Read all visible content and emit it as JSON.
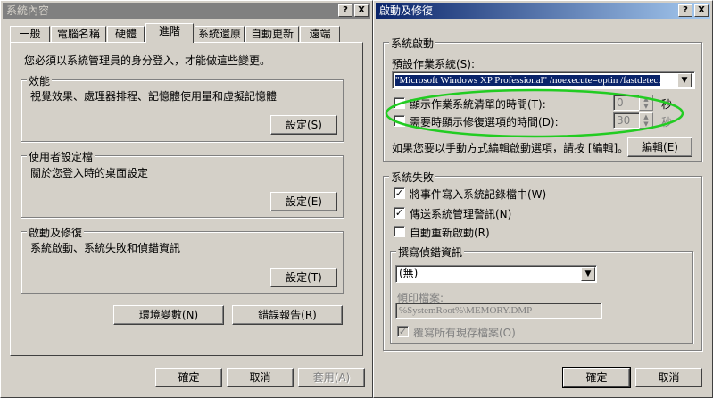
{
  "left": {
    "title": "系統內容",
    "help_btn": "?",
    "close_btn": "X",
    "tabs": [
      "一般",
      "電腦名稱",
      "硬體",
      "進階",
      "系統還原",
      "自動更新",
      "遠端"
    ],
    "admin_note": "您必須以系統管理員的身分登入，才能做這些變更。",
    "performance": {
      "title": "效能",
      "desc": "視覺效果、處理器排程、記憶體使用量和虛擬記憶體",
      "button": "設定(S)"
    },
    "profiles": {
      "title": "使用者設定檔",
      "desc": "關於您登入時的桌面設定",
      "button": "設定(E)"
    },
    "startup": {
      "title": "啟動及修復",
      "desc": "系統啟動、系統失敗和偵錯資訊",
      "button": "設定(T)"
    },
    "env_button": "環境變數(N)",
    "error_button": "錯誤報告(R)",
    "ok": "確定",
    "cancel": "取消",
    "apply": "套用(A)"
  },
  "right": {
    "title": "啟動及修復",
    "help_btn": "?",
    "close_btn": "X",
    "system_startup": {
      "title": "系統啟動",
      "default_os_label": "預設作業系統(S):",
      "default_os_value": "\"Microsoft Windows XP Professional\" /noexecute=optin /fastdetect",
      "show_os_list_label": "顯示作業系統清單的時間(T):",
      "show_os_list_value": "0",
      "show_recovery_label": "需要時顯示修復選項的時間(D):",
      "show_recovery_value": "30",
      "seconds1": "秒",
      "seconds2": "秒",
      "edit_note": "如果您要以手動方式編輯啟動選項，請按 [編輯]。",
      "edit_button": "編輯(E)"
    },
    "system_failure": {
      "title": "系統失敗",
      "write_event": "將事件寫入系統記錄檔中(W)",
      "send_alert": "傳送系統管理警訊(N)",
      "auto_restart": "自動重新啟動(R)",
      "debug_title": "撰寫偵錯資訊",
      "debug_value": "(無)",
      "dump_file_label": "傾印檔案:",
      "dump_file_value": "%SystemRoot%\\MEMORY.DMP",
      "overwrite": "覆寫所有現存檔案(O)"
    },
    "ok": "確定",
    "cancel": "取消"
  },
  "colors": {
    "highlight": "#0a246a",
    "annotation": "#22cc22"
  }
}
